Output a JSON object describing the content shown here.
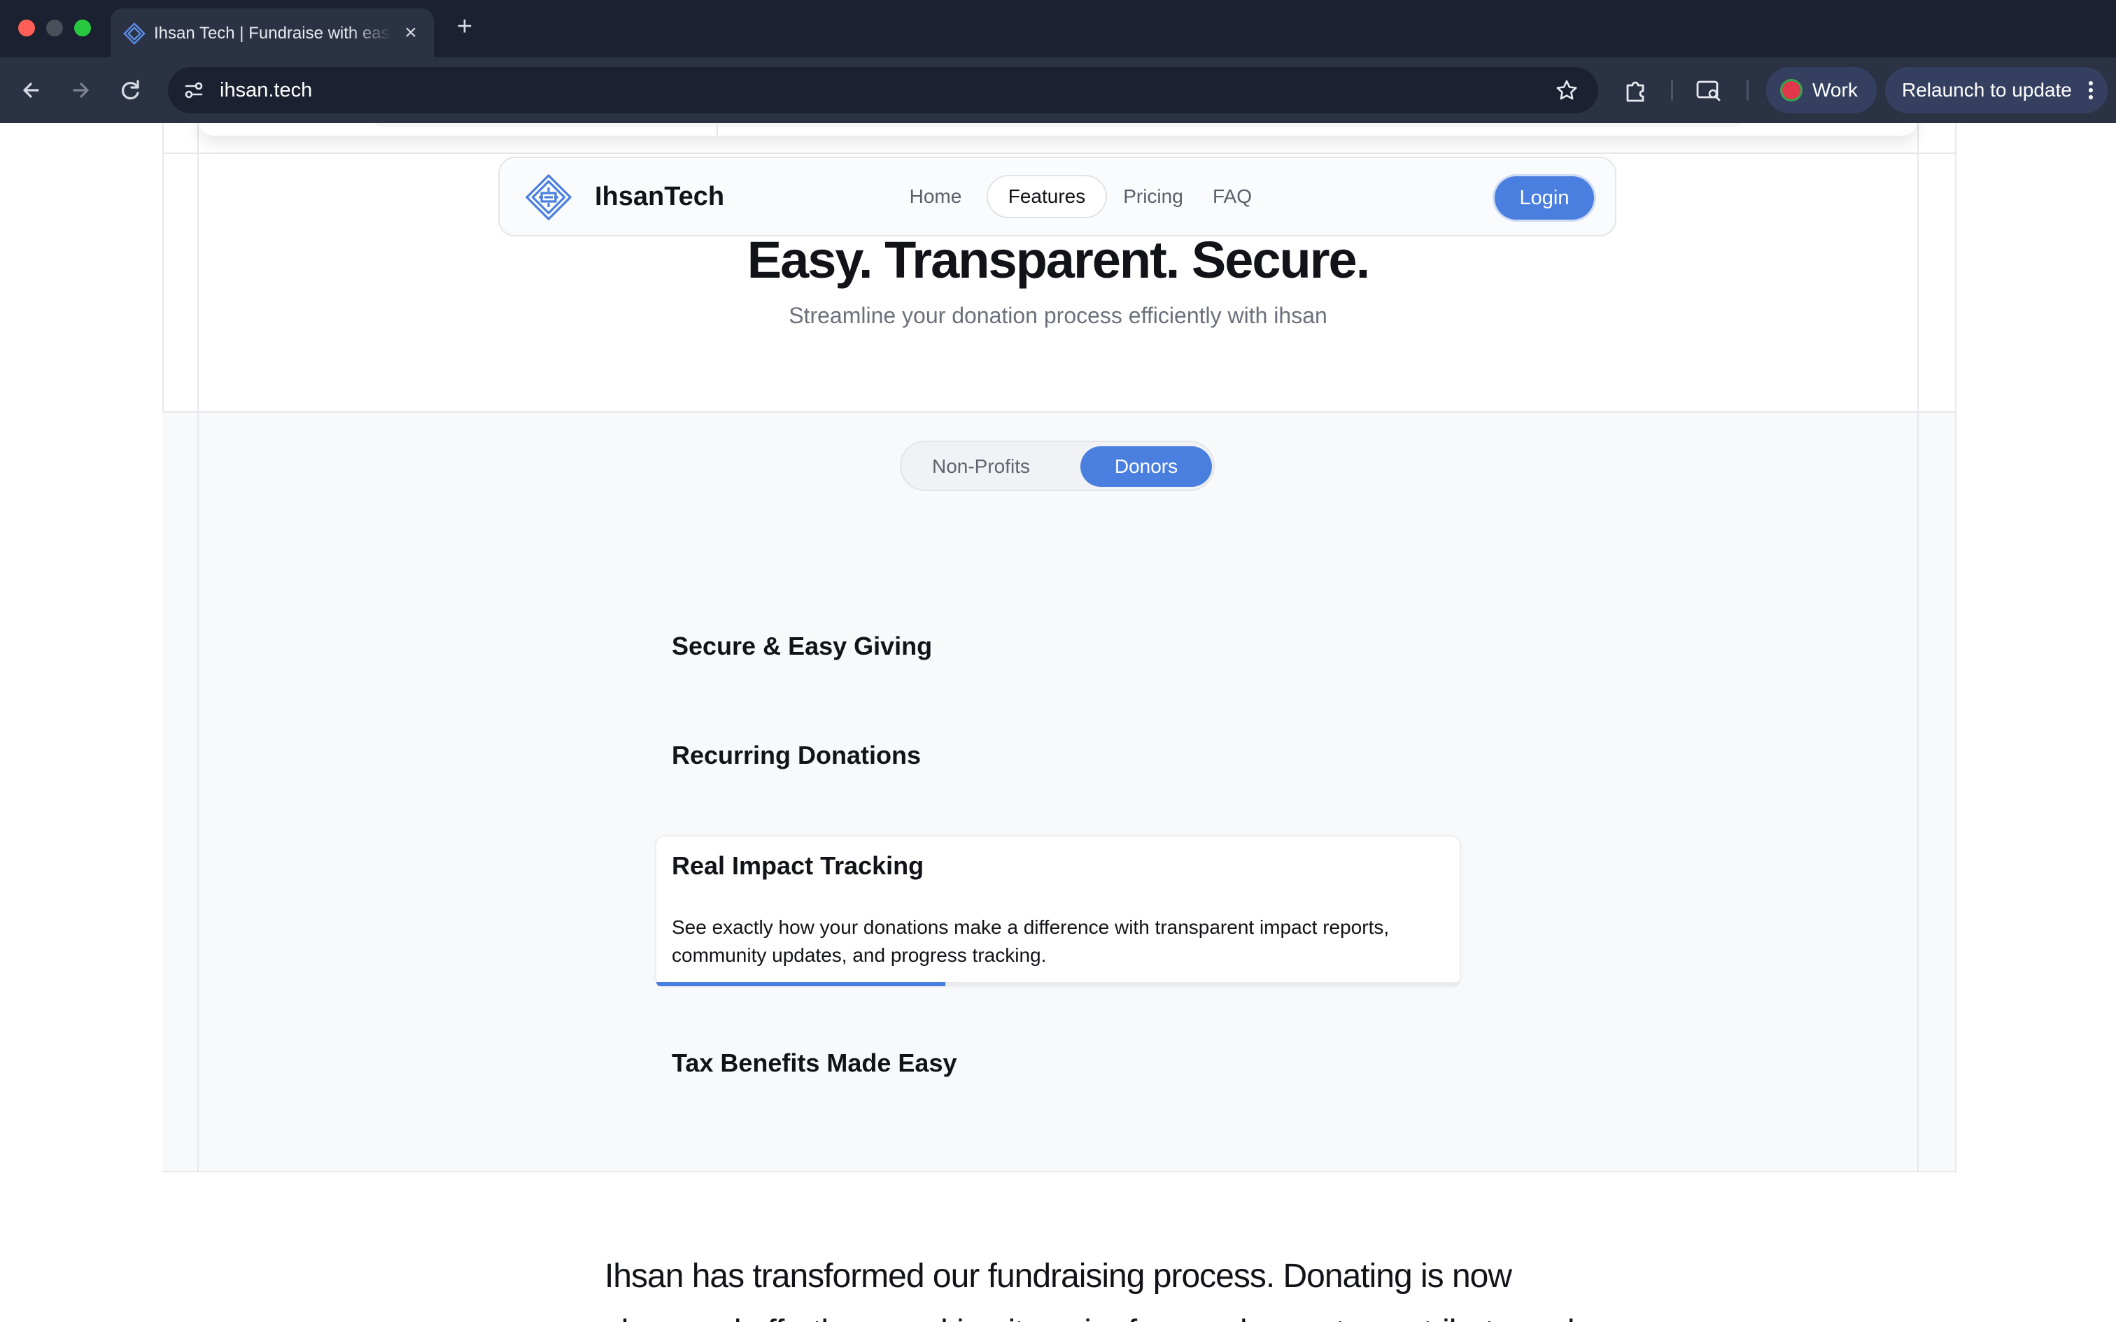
{
  "browser": {
    "tab_title": "Ihsan Tech | Fundraise with ease",
    "url": "ihsan.tech",
    "profile_label": "Work",
    "relaunch_label": "Relaunch to update",
    "icons": [
      "close-icon",
      "plus-icon",
      "back-icon",
      "forward-icon",
      "reload-icon",
      "site-info-icon",
      "star-icon",
      "extensions-icon",
      "cast-icon",
      "kebab-menu-icon"
    ]
  },
  "navbar": {
    "brand": "IhsanTech",
    "links": [
      {
        "label": "Home",
        "active": false
      },
      {
        "label": "Features",
        "active": true
      },
      {
        "label": "Pricing",
        "active": false
      },
      {
        "label": "FAQ",
        "active": false
      }
    ],
    "login_label": "Login"
  },
  "hero": {
    "title": "Easy. Transparent. Secure.",
    "subtitle": "Streamline your donation process efficiently with ihsan"
  },
  "audience_toggle": {
    "options": [
      "Non-Profits",
      "Donors"
    ],
    "selected": "Donors"
  },
  "features": [
    {
      "title": "Secure & Easy Giving",
      "expanded": false
    },
    {
      "title": "Recurring Donations",
      "expanded": false
    },
    {
      "title": "Real Impact Tracking",
      "expanded": true,
      "description": "See exactly how your donations make a difference with transparent impact reports, community updates, and progress tracking.",
      "progress": 0.36
    },
    {
      "title": "Tax Benefits Made Easy",
      "expanded": false
    }
  ],
  "testimonial": {
    "line1": "Ihsan has transformed our fundraising process. Donating is now",
    "line2": "seamless and effortless, making it easier for our donors to contribute and"
  },
  "colors": {
    "accent": "#4a7fe0",
    "chrome_bg": "#1b2130",
    "toolbar_bg": "#2b3244",
    "page_bg": "#ffffff",
    "section_bg": "#f8f9fb"
  }
}
